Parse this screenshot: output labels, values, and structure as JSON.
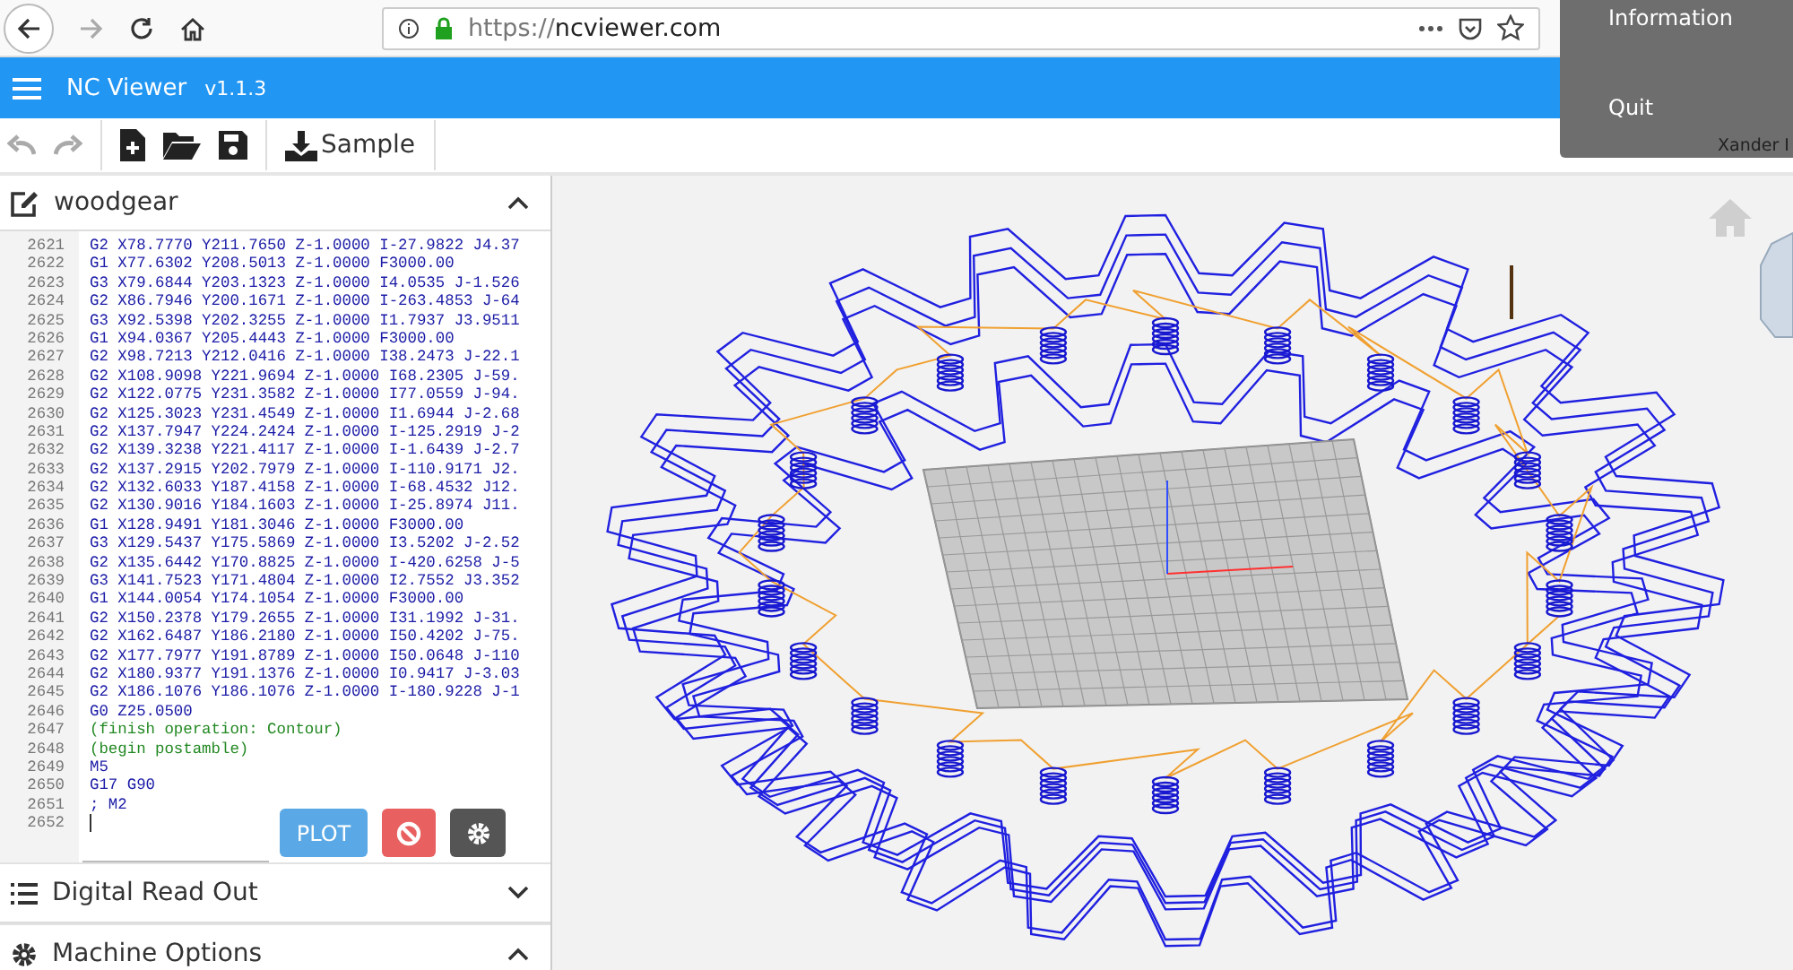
{
  "browser": {
    "url_scheme": "https://",
    "url_host": "ncviewer.com"
  },
  "overlay_menu": {
    "items": [
      "Information",
      "Quit"
    ],
    "footer": "Xander I"
  },
  "app_bar": {
    "title": "NC Viewer",
    "version": "v1.1.3"
  },
  "toolbar": [
    {
      "kind": "undo",
      "disabled": true
    },
    {
      "kind": "redo",
      "disabled": true
    },
    {
      "kind": "new",
      "disabled": false
    },
    {
      "kind": "open",
      "disabled": false
    },
    {
      "kind": "save",
      "disabled": false
    },
    {
      "kind": "sample",
      "label": "Sample",
      "disabled": false
    }
  ],
  "editor": {
    "title": "woodgear",
    "expanded": true,
    "lines": [
      {
        "number": "2621",
        "text": "G2 X78.7770 Y211.7650 Z-1.0000 I-27.9822 J4.37",
        "kind": "code"
      },
      {
        "number": "2622",
        "text": "G1 X77.6302 Y208.5013 Z-1.0000 F3000.00",
        "kind": "code"
      },
      {
        "number": "2623",
        "text": "G3 X79.6844 Y203.1323 Z-1.0000 I4.0535 J-1.526",
        "kind": "code"
      },
      {
        "number": "2624",
        "text": "G2 X86.7946 Y200.1671 Z-1.0000 I-263.4853 J-64",
        "kind": "code"
      },
      {
        "number": "2625",
        "text": "G3 X92.5398 Y202.3255 Z-1.0000 I1.7937 J3.9511",
        "kind": "code"
      },
      {
        "number": "2626",
        "text": "G1 X94.0367 Y205.4443 Z-1.0000 F3000.00",
        "kind": "code"
      },
      {
        "number": "2627",
        "text": "G2 X98.7213 Y212.0416 Z-1.0000 I38.2473 J-22.1",
        "kind": "code"
      },
      {
        "number": "2628",
        "text": "G2 X108.9098 Y221.9694 Z-1.0000 I68.2305 J-59.",
        "kind": "code"
      },
      {
        "number": "2629",
        "text": "G2 X122.0775 Y231.3582 Z-1.0000 I77.0559 J-94.",
        "kind": "code"
      },
      {
        "number": "2630",
        "text": "G2 X125.3023 Y231.4549 Z-1.0000 I1.6944 J-2.68",
        "kind": "code"
      },
      {
        "number": "2631",
        "text": "G2 X137.7947 Y224.2424 Z-1.0000 I-125.2919 J-2",
        "kind": "code"
      },
      {
        "number": "2632",
        "text": "G2 X139.3238 Y221.4117 Z-1.0000 I-1.6439 J-2.7",
        "kind": "code"
      },
      {
        "number": "2633",
        "text": "G2 X137.2915 Y202.7979 Z-1.0000 I-110.9171 J2.",
        "kind": "code"
      },
      {
        "number": "2634",
        "text": "G2 X132.6033 Y187.4158 Z-1.0000 I-68.4532 J12.",
        "kind": "code"
      },
      {
        "number": "2635",
        "text": "G2 X130.9016 Y184.1603 Z-1.0000 I-25.8974 J11.",
        "kind": "code"
      },
      {
        "number": "2636",
        "text": "G1 X128.9491 Y181.3046 Z-1.0000 F3000.00",
        "kind": "code"
      },
      {
        "number": "2637",
        "text": "G3 X129.5437 Y175.5869 Z-1.0000 I3.5202 J-2.52",
        "kind": "code"
      },
      {
        "number": "2638",
        "text": "G2 X135.6442 Y170.8825 Z-1.0000 I-420.6258 J-5",
        "kind": "code"
      },
      {
        "number": "2639",
        "text": "G3 X141.7523 Y171.4804 Z-1.0000 I2.7552 J3.352",
        "kind": "code"
      },
      {
        "number": "2640",
        "text": "G1 X144.0054 Y174.1054 Z-1.0000 F3000.00",
        "kind": "code"
      },
      {
        "number": "2641",
        "text": "G2 X150.2378 Y179.2655 Z-1.0000 I31.1992 J-31.",
        "kind": "code"
      },
      {
        "number": "2642",
        "text": "G2 X162.6487 Y186.2180 Z-1.0000 I50.4202 J-75.",
        "kind": "code"
      },
      {
        "number": "2643",
        "text": "G2 X177.7977 Y191.8789 Z-1.0000 I50.0648 J-110",
        "kind": "code"
      },
      {
        "number": "2644",
        "text": "G2 X180.9377 Y191.1376 Z-1.0000 I0.9417 J-3.03",
        "kind": "code"
      },
      {
        "number": "2645",
        "text": "G2 X186.1076 Y186.1076 Z-1.0000 I-180.9228 J-1",
        "kind": "code"
      },
      {
        "number": "2646",
        "text": "G0 Z25.0500",
        "kind": "code"
      },
      {
        "number": "2647",
        "text": "(finish operation: Contour)",
        "kind": "comment"
      },
      {
        "number": "2648",
        "text": "(begin postamble)",
        "kind": "comment"
      },
      {
        "number": "2649",
        "text": "M5",
        "kind": "code"
      },
      {
        "number": "2650",
        "text": "G17 G90",
        "kind": "code"
      },
      {
        "number": "2651",
        "text": "; M2",
        "kind": "code"
      },
      {
        "number": "2652",
        "kind": "cursor"
      }
    ],
    "plot_button": "PLOT"
  },
  "sections": [
    {
      "title": "Digital Read Out",
      "kind": "list",
      "expanded": false
    },
    {
      "title": "Machine Options",
      "kind": "gear",
      "expanded": true
    }
  ]
}
